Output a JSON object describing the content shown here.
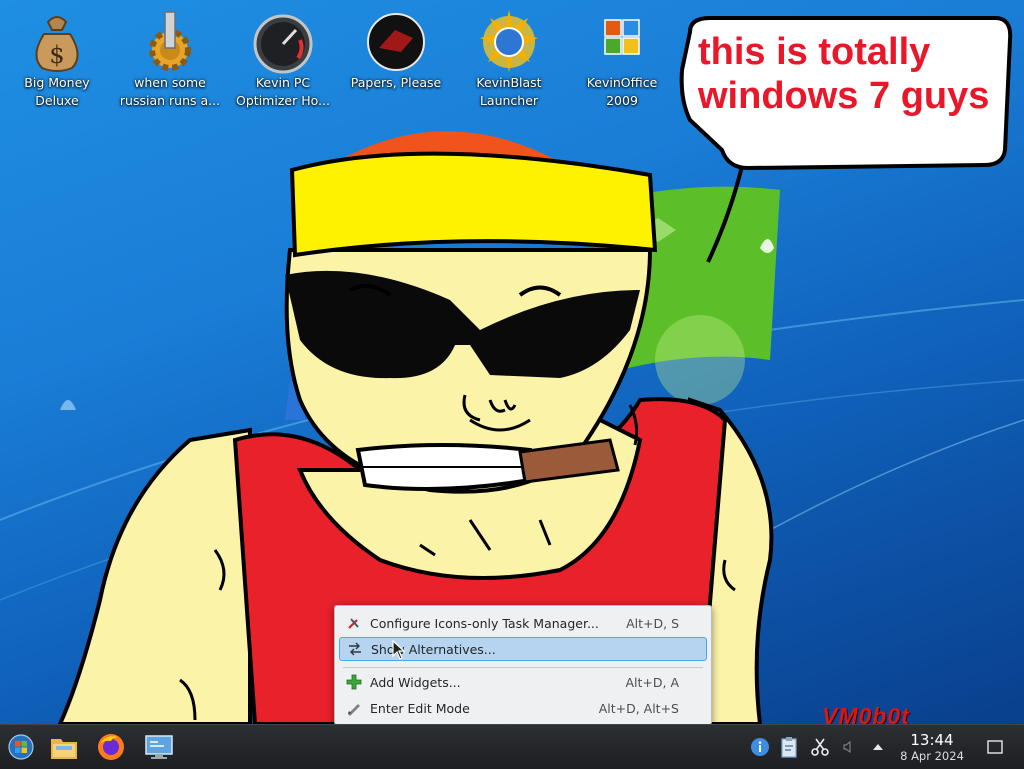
{
  "desktop": {
    "icons": [
      {
        "label": "Big Money\nDeluxe",
        "icon": "money-bag-icon"
      },
      {
        "label": "when some\nrussian runs a...",
        "icon": "gear-tap-icon"
      },
      {
        "label": "Kevin PC\nOptimizer Ho...",
        "icon": "speedometer-icon"
      },
      {
        "label": "Papers, Please",
        "icon": "papers-please-emblem-icon"
      },
      {
        "label": "KevinBlast\nLauncher",
        "icon": "sun-disc-icon"
      },
      {
        "label": "KevinOffice\n2009",
        "icon": "office-logo-icon"
      }
    ],
    "speech_bubble": "this is totally windows 7 guys",
    "watermark": "VM0b0t"
  },
  "context_menu": {
    "items": [
      {
        "label": "Configure Icons-only Task Manager...",
        "shortcut": "Alt+D, S",
        "icon": "configure-icon",
        "highlighted": false
      },
      {
        "label": "Show Alternatives...",
        "shortcut": "",
        "icon": "alternatives-icon",
        "highlighted": true
      },
      {
        "label": "Add Widgets...",
        "shortcut": "Alt+D, A",
        "icon": "add-icon",
        "highlighted": false
      },
      {
        "label": "Enter Edit Mode",
        "shortcut": "Alt+D, Alt+S",
        "icon": "edit-mode-icon",
        "highlighted": false
      }
    ]
  },
  "taskbar": {
    "launchers": [
      "start-menu-icon",
      "file-manager-icon",
      "firefox-icon",
      "system-settings-icon"
    ],
    "tray": [
      "info-icon",
      "clipboard-icon",
      "scissors-icon",
      "volume-icon",
      "expand-tray-icon"
    ],
    "clock": {
      "time": "13:44",
      "date": "8 Apr 2024"
    },
    "show_desktop": "show-desktop-icon"
  },
  "colors": {
    "accent": "#3daee9",
    "highlight": "#b6d4ef",
    "bubble_text": "#e8182a",
    "taskbar": "#25282b"
  }
}
